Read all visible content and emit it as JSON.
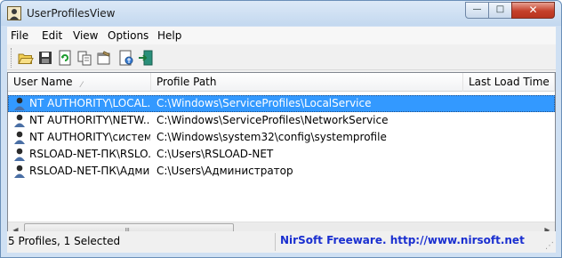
{
  "window": {
    "title": "UserProfilesView",
    "icons": {
      "app": "user-profile-app-icon",
      "minimize": "minimize-icon",
      "maximize": "maximize-icon",
      "close": "close-icon"
    },
    "minimize_glyph": "—",
    "maximize_glyph": "□",
    "close_glyph": "✕"
  },
  "menu": [
    "File",
    "Edit",
    "View",
    "Options",
    "Help"
  ],
  "toolbar": {
    "buttons": [
      "open-folder-icon",
      "save-icon",
      "refresh-icon",
      "copy-icon",
      "properties-icon",
      "html-report-icon",
      "exit-icon"
    ]
  },
  "columns": [
    {
      "label": "User Name",
      "sorted": true
    },
    {
      "label": "Profile Path"
    },
    {
      "label": "Last Load Time"
    }
  ],
  "sort_indicator": "⁄",
  "rows": [
    {
      "user": "NT AUTHORITY\\LOCAL...",
      "path": "C:\\Windows\\ServiceProfiles\\LocalService",
      "selected": true
    },
    {
      "user": "NT AUTHORITY\\NETW...",
      "path": "C:\\Windows\\ServiceProfiles\\NetworkService"
    },
    {
      "user": "NT AUTHORITY\\система",
      "path": "C:\\Windows\\system32\\config\\systemprofile"
    },
    {
      "user": "RSLOAD-NET-ПК\\RSLO...",
      "path": "C:\\Users\\RSLOAD-NET"
    },
    {
      "user": "RSLOAD-NET-ПК\\Адми...",
      "path": "C:\\Users\\Администратор"
    }
  ],
  "scrollbar": {
    "left_glyph": "◀",
    "right_glyph": "▶",
    "grip_glyph": "|||"
  },
  "status": {
    "left": "5 Profiles, 1 Selected",
    "link": "NirSoft Freeware.  http://www.nirsoft.net",
    "grip_glyph": "⋰"
  },
  "colors": {
    "selection": "#3399ff",
    "link": "#1a2fd0",
    "close_button": "#c5402a"
  }
}
